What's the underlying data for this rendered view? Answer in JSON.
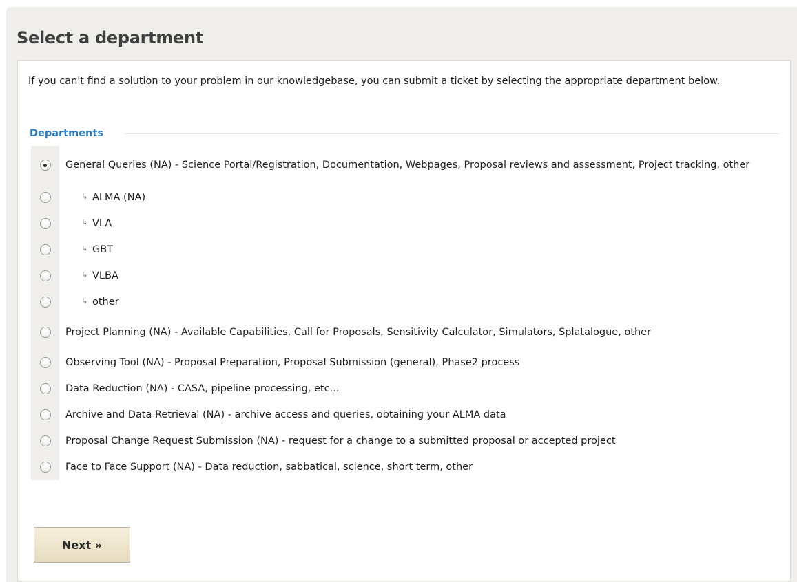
{
  "page_title": "Select a department",
  "intro_text": "If you can't find a solution to your problem in our knowledgebase, you can submit a ticket by selecting the appropriate department below.",
  "departments_legend": "Departments",
  "sub_arrow_glyph": "↳",
  "departments": [
    {
      "label": "General Queries (NA) - Science Portal/Registration, Documentation, Webpages, Proposal reviews and assessment, Project tracking, other",
      "selected": true,
      "sub": false
    },
    {
      "label": "ALMA (NA)",
      "selected": false,
      "sub": true
    },
    {
      "label": "VLA",
      "selected": false,
      "sub": true
    },
    {
      "label": "GBT",
      "selected": false,
      "sub": true
    },
    {
      "label": "VLBA",
      "selected": false,
      "sub": true
    },
    {
      "label": "other",
      "selected": false,
      "sub": true
    },
    {
      "label": "Project Planning (NA) - Available Capabilities, Call for Proposals, Sensitivity Calculator, Simulators, Splatalogue, other",
      "selected": false,
      "sub": false
    },
    {
      "label": "Observing Tool (NA) - Proposal Preparation, Proposal Submission (general), Phase2 process",
      "selected": false,
      "sub": false
    },
    {
      "label": "Data Reduction (NA) - CASA, pipeline processing, etc...",
      "selected": false,
      "sub": false
    },
    {
      "label": "Archive and Data Retrieval (NA) - archive access and queries, obtaining your ALMA data",
      "selected": false,
      "sub": false
    },
    {
      "label": "Proposal Change Request Submission (NA) - request for a change to a submitted proposal or accepted project",
      "selected": false,
      "sub": false
    },
    {
      "label": "Face to Face Support (NA) - Data reduction, sabbatical, science, short term, other",
      "selected": false,
      "sub": false
    }
  ],
  "next_button_label": "Next »",
  "colors": {
    "background": "#efeeea",
    "legend_blue": "#2d7bc1",
    "button_top": "#f6efdc",
    "button_bottom": "#e7dcc0"
  }
}
